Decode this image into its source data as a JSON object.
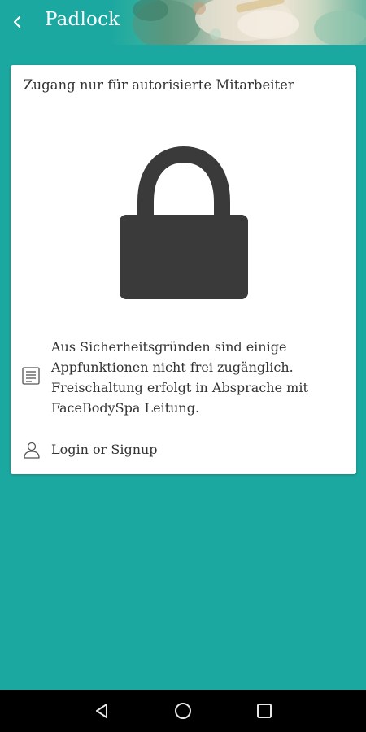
{
  "app_bar": {
    "title": "Padlock",
    "back_icon": "chevron-left-icon"
  },
  "card": {
    "heading": "Zugang nur für autorisierte Mitarbeiter",
    "lock_icon": "padlock-icon",
    "notice": {
      "icon": "document-list-icon",
      "text_lines": [
        "Aus Sicherheitsgründen sind einige",
        "Appfunktionen nicht frei zugänglich.",
        "Freischaltung erfolgt in Absprache mit",
        "FaceBodySpa Leitung."
      ]
    },
    "login": {
      "icon": "user-icon",
      "label": "Login or Signup"
    }
  },
  "nav_bar": {
    "back_icon": "triangle-back-icon",
    "home_icon": "circle-home-icon",
    "recents_icon": "square-recents-icon"
  },
  "colors": {
    "background": "#1ba8a0",
    "card": "#ffffff",
    "lock": "#3a3a3a",
    "text": "#333333",
    "nav_bar": "#000000"
  }
}
